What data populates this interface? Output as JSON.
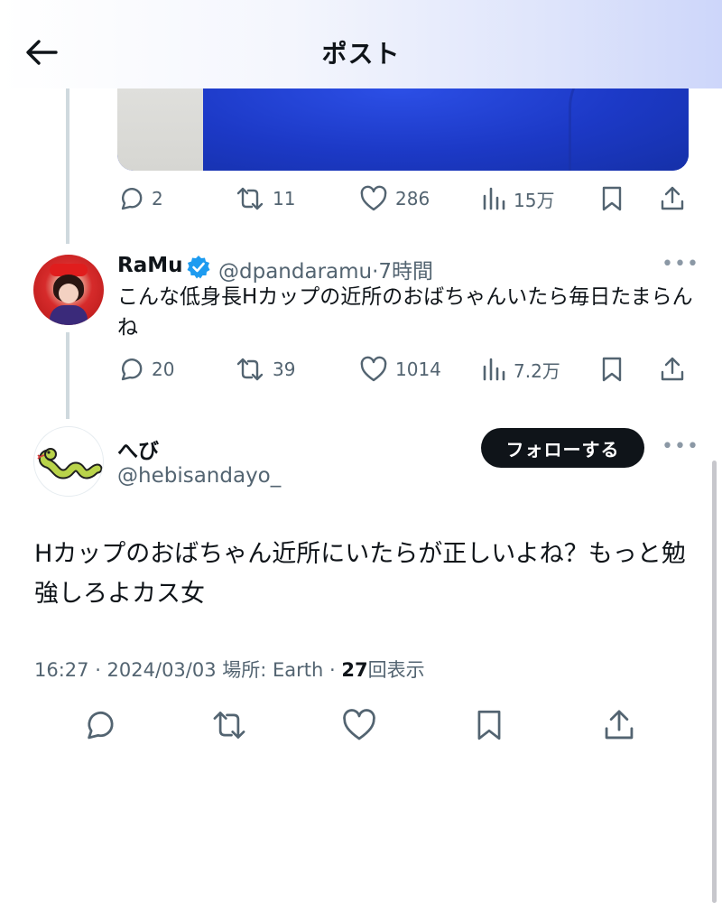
{
  "header": {
    "title": "ポスト"
  },
  "colors": {
    "text": "#0f1419",
    "muted": "#536471",
    "verified": "#1d9bf0",
    "follow_bg": "#0f1419"
  },
  "prev_post_actions": {
    "replies": "2",
    "reposts": "11",
    "likes": "286",
    "views": "15万"
  },
  "reply": {
    "name": "RaMu",
    "verified": true,
    "handle": "@dpandaramu",
    "time": "7時間",
    "text": "こんな低身長Hカップの近所のおばちゃんいたら毎日たまらんね",
    "actions": {
      "replies": "20",
      "reposts": "39",
      "likes": "1014",
      "views": "7.2万"
    }
  },
  "main_post": {
    "name": "へび",
    "handle": "@hebisandayo_",
    "follow_label": "フォローする",
    "text": "Hカップのおばちゃん近所にいたらが正しいよね？もっと勉強しろよカス女",
    "meta": {
      "time_date": "16:27 · 2024/03/03",
      "place": "場所: Earth ·",
      "view_count": "27",
      "view_label": "回表示"
    }
  },
  "icons": [
    "back-arrow-icon",
    "reply-icon",
    "repost-icon",
    "like-icon",
    "views-icon",
    "bookmark-icon",
    "share-icon",
    "verified-badge-icon",
    "more-icon"
  ]
}
